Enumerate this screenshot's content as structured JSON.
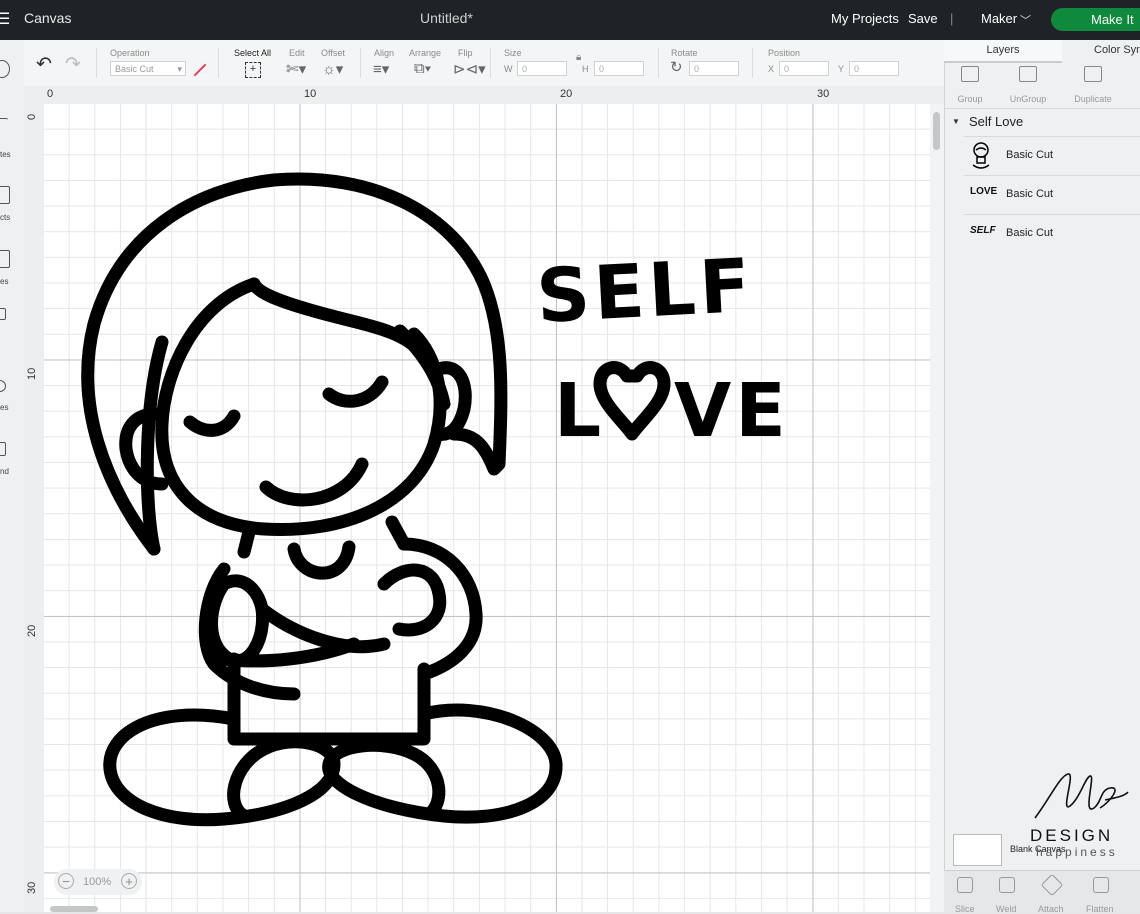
{
  "topbar": {
    "menu_icon": "hamburger-icon",
    "app_title": "Canvas",
    "doc_title": "Untitled*",
    "my_projects": "My Projects",
    "save": "Save",
    "separator": "|",
    "machine": "Maker",
    "make_it": "Make It",
    "accent_color": "#0f8a3c"
  },
  "left_rail": [
    "tes",
    "cts",
    "es",
    "es",
    "nd"
  ],
  "toolbar": {
    "select_all": "Select All",
    "operation_label": "Operation",
    "operation_value": "Basic Cut",
    "edit_label": "Edit",
    "offset_label": "Offset",
    "align_label": "Align",
    "arrange_label": "Arrange",
    "flip_label": "Flip",
    "size_label": "Size",
    "width_prefix": "W",
    "width_value": "0",
    "height_prefix": "H",
    "height_value": "0",
    "rotate_label": "Rotate",
    "rotate_value": "0",
    "position_label": "Position",
    "x_prefix": "X",
    "x_value": "0",
    "y_prefix": "Y",
    "y_value": "0"
  },
  "ruler": {
    "top": [
      "0",
      "10",
      "20",
      "30"
    ],
    "left": [
      "0",
      "10",
      "20",
      "30"
    ]
  },
  "canvas": {
    "zoom": "100%",
    "zoom_out": "−",
    "zoom_in": "+",
    "art_text": {
      "line1": "SELF",
      "line2_left": "L",
      "line2_right": "VE"
    }
  },
  "panel": {
    "tabs": [
      "Layers",
      "Color Sync"
    ],
    "buttons": [
      "Group",
      "UnGroup",
      "Duplicate"
    ],
    "group_name": "Self Love",
    "layers": [
      {
        "thumb": "girl-icon",
        "thumb_text": "",
        "label": "Basic Cut"
      },
      {
        "thumb": "love-text",
        "thumb_text": "LOVE",
        "label": "Basic Cut"
      },
      {
        "thumb": "self-text",
        "thumb_text": "SELF",
        "label": "Basic Cut"
      }
    ],
    "blank_canvas": "Blank Canvas",
    "bottom_tools": [
      "Slice",
      "Weld",
      "Attach",
      "Flatten"
    ]
  },
  "watermark": {
    "design": "DESIGN",
    "tagline": "happiness"
  }
}
